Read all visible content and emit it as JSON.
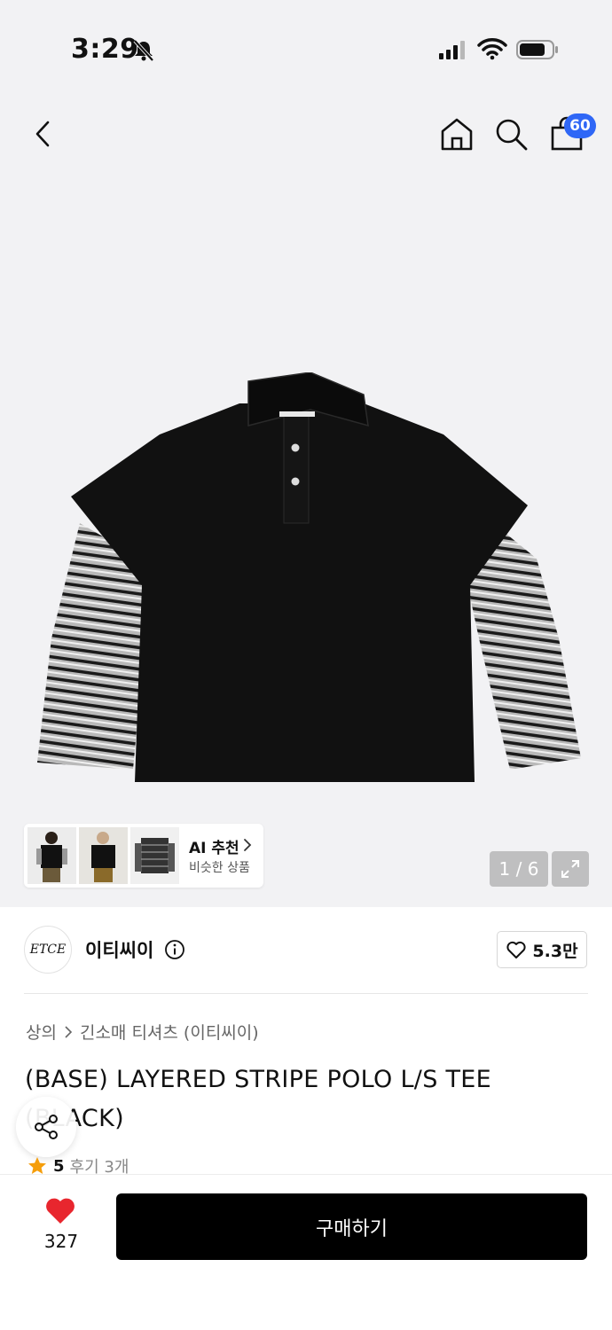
{
  "status_bar": {
    "time": "3:29",
    "icons": [
      "bell-slash-icon",
      "cellular-signal-icon",
      "wifi-icon",
      "battery-icon"
    ]
  },
  "nav": {
    "icons": [
      "back-icon",
      "home-icon",
      "search-icon",
      "shopping-bag-icon"
    ],
    "cart_count": "60"
  },
  "gallery": {
    "ai_recommend": {
      "title": "AI 추천",
      "subtitle": "비슷한 상품"
    },
    "page_counter": "1 / 6",
    "current_image": 1,
    "total_images": 6
  },
  "brand": {
    "logo_text": "ETCE",
    "name": "이티씨이",
    "likes": "5.3만"
  },
  "breadcrumb": [
    "상의",
    "긴소매 티셔츠 (이티씨이)"
  ],
  "product": {
    "title": "(BASE) LAYERED STRIPE POLO L/S TEE (BLACK)"
  },
  "rating": {
    "score": "5",
    "reviews": "후기 3개"
  },
  "bottom_bar": {
    "wish_count": "327",
    "buy_label": "구매하기"
  },
  "colors": {
    "accent_badge": "#2f67f6",
    "heart": "#e8262e",
    "star": "#f59e0b",
    "buy_button": "#000000"
  }
}
